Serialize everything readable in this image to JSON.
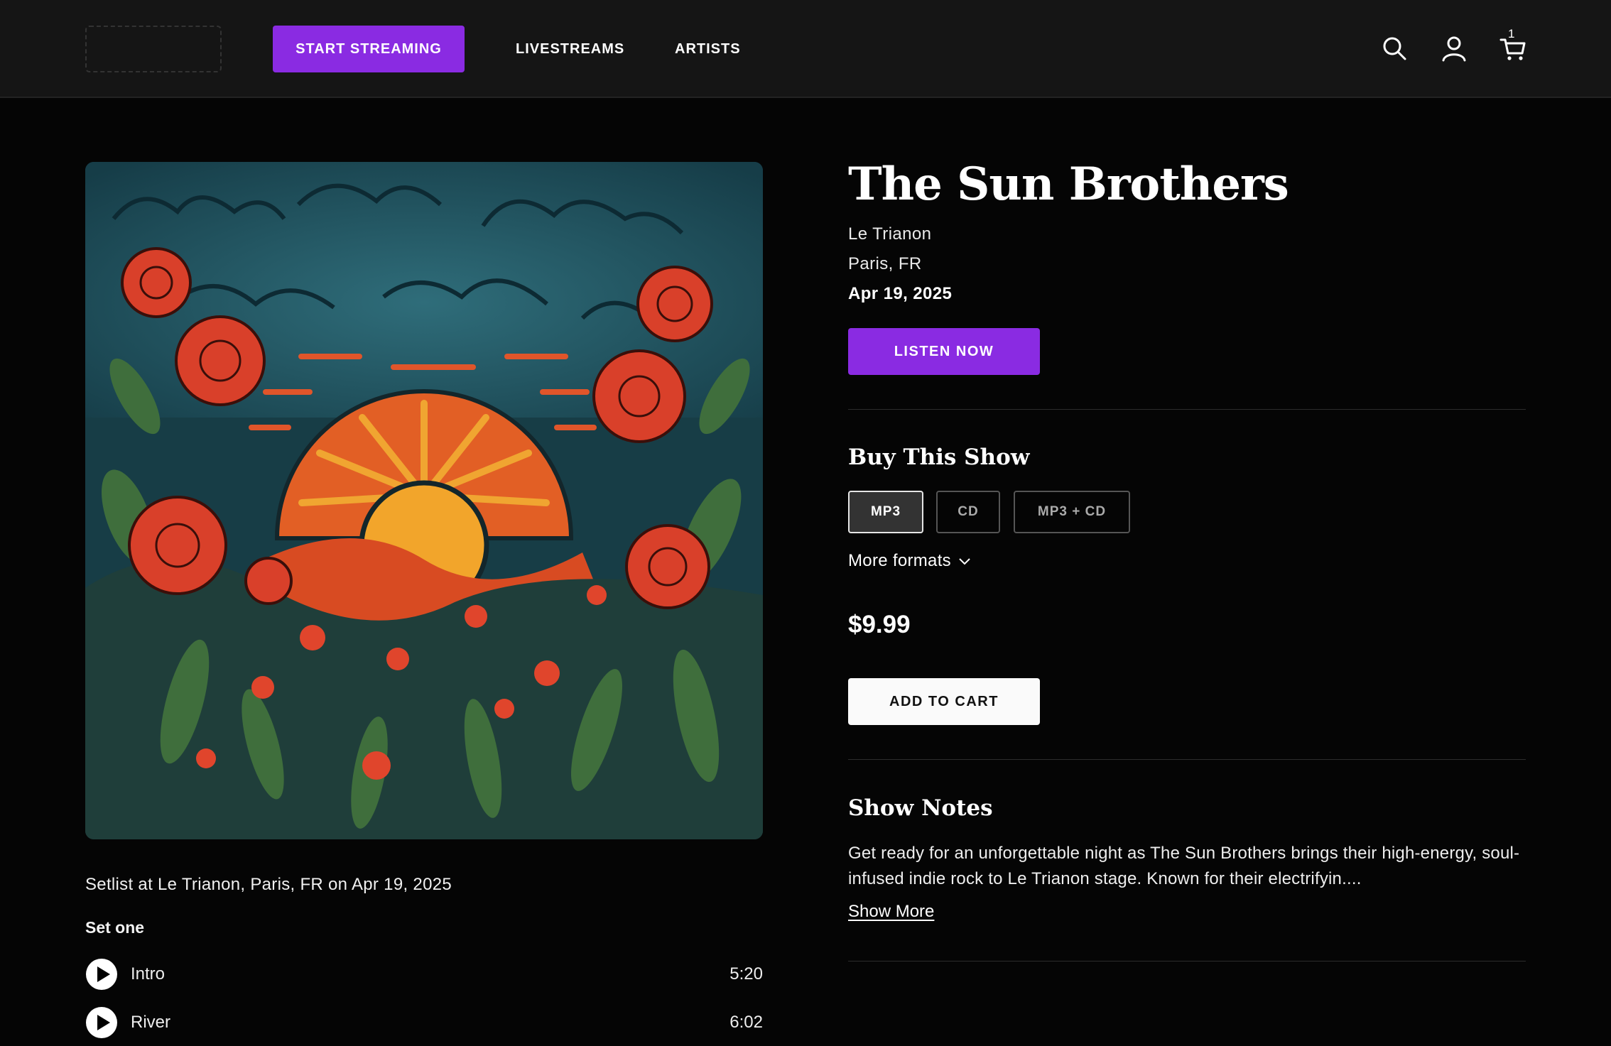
{
  "header": {
    "start_streaming": "START STREAMING",
    "nav": [
      "LIVESTREAMS",
      "ARTISTS"
    ],
    "cart_count": "1",
    "icons": [
      "search-icon",
      "user-icon",
      "cart-icon"
    ]
  },
  "show": {
    "artist": "The Sun Brothers",
    "venue": "Le Trianon",
    "location": "Paris, FR",
    "date": "Apr 19, 2025",
    "listen_label": "LISTEN NOW"
  },
  "buy": {
    "heading": "Buy This Show",
    "formats": [
      "MP3",
      "CD",
      "MP3 + CD"
    ],
    "selected_format": "MP3",
    "more_formats": "More formats",
    "price": "$9.99",
    "add_to_cart": "ADD TO CART"
  },
  "notes": {
    "heading": "Show Notes",
    "text": "Get ready for an unforgettable night as The Sun Brothers brings their high-energy, soul-infused indie rock to Le Trianon stage. Known for their electrifyin....",
    "show_more": "Show More"
  },
  "setlist": {
    "title": "Setlist at Le Trianon, Paris, FR on Apr 19, 2025",
    "set_label": "Set one",
    "tracks": [
      {
        "name": "Intro",
        "duration": "5:20"
      },
      {
        "name": "River",
        "duration": "6:02"
      }
    ]
  },
  "colors": {
    "accent": "#8a2be2",
    "background": "#050505",
    "header": "#151515"
  }
}
